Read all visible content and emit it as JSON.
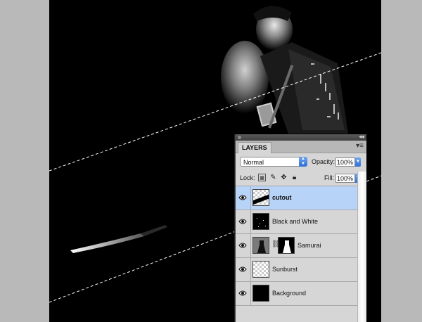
{
  "panel": {
    "tab_label": "LAYERS",
    "menu_icon": "panel-menu-icon",
    "blend_mode": "Normal",
    "opacity_label": "Opacity:",
    "opacity_value": "100%",
    "lock_label": "Lock:",
    "fill_label": "Fill:",
    "fill_value": "100%"
  },
  "layers": [
    {
      "name": "cutout",
      "selected": true,
      "thumb": "checker-stripe"
    },
    {
      "name": "Black and White",
      "selected": false,
      "thumb": "black-dots"
    },
    {
      "name": "Samurai",
      "selected": false,
      "thumb": "figure-with-mask"
    },
    {
      "name": "Sunburst",
      "selected": false,
      "thumb": "checker"
    },
    {
      "name": "Background",
      "selected": false,
      "thumb": "black"
    }
  ],
  "colors": {
    "selected_row": "#b7d3f7",
    "panel_bg": "#d6d6d6",
    "accent_blue": "#2f6fd8"
  }
}
